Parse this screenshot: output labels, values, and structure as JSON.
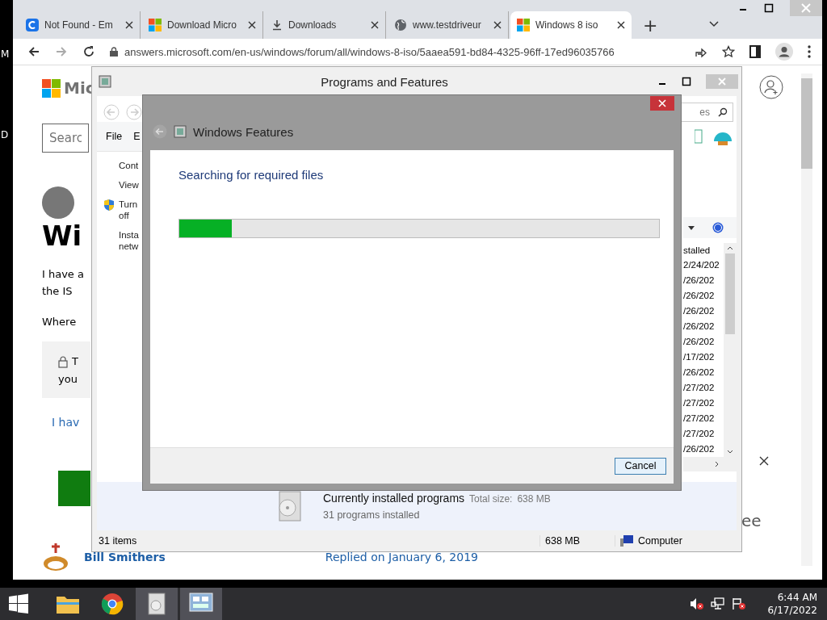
{
  "desktop_labels": [
    "M",
    "D"
  ],
  "browser": {
    "tabs": [
      {
        "label": "Not Found - Em",
        "kind": "c",
        "selected": false
      },
      {
        "label": "Download Micro",
        "kind": "ms",
        "selected": false
      },
      {
        "label": "Downloads",
        "kind": "download",
        "selected": false
      },
      {
        "label": "www.testdriveur",
        "kind": "globe",
        "selected": false
      },
      {
        "label": "Windows 8 iso",
        "kind": "ms",
        "selected": true
      }
    ],
    "new_tab": "+",
    "url": "answers.microsoft.com/en-us/windows/forum/all/windows-8-iso/5aaea591-bd84-4325-96ff-17ed96035766",
    "page": {
      "logo_text": "Mic",
      "search_placeholder": "Searc",
      "heading": "Wi",
      "paragraph_lines": [
        "I have a",
        "the IS"
      ],
      "question": "Where",
      "notice_lines": [
        "T",
        "you"
      ],
      "link": "I hav",
      "author": "Bill Smithers",
      "reply_date": "Replied on January 6, 2019",
      "side_text": "ee"
    }
  },
  "programs_window": {
    "title": "Programs and Features",
    "menu": [
      "File",
      "E"
    ],
    "tasks": [
      {
        "label": "Cont",
        "shield": false
      },
      {
        "label": "View",
        "shield": false
      },
      {
        "label": "Turn\noff",
        "shield": true
      },
      {
        "label": "Insta\nnetw",
        "shield": false
      }
    ],
    "search_text": "es",
    "column_header": "stalled",
    "dates": [
      "2/24/202",
      "/26/202",
      "/26/202",
      "/26/202",
      "/26/202",
      "/26/202",
      "/17/202",
      "/26/202",
      "/27/202",
      "/27/202",
      "/27/202",
      "/27/202",
      "/26/202"
    ],
    "summary_title": "Currently installed programs",
    "summary_size_label": "Total size:",
    "summary_size": "638 MB",
    "summary_count": "31 programs installed",
    "status": {
      "items": "31 items",
      "size": "638 MB",
      "location": "Computer"
    }
  },
  "features_dialog": {
    "title": "Windows Features",
    "message": "Searching for required files",
    "progress": {
      "level": 0.11
    },
    "button": "Cancel"
  },
  "taskbar": {
    "time": "6:44 AM",
    "date": "6/17/2022"
  }
}
